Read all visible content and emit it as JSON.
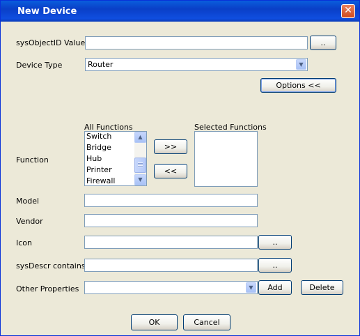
{
  "window": {
    "title": "New Device",
    "close_glyph": "✕"
  },
  "form": {
    "sysobjectid_label": "sysObjectID Value",
    "sysobjectid_value": "",
    "browse_label": "..",
    "device_type_label": "Device Type",
    "device_type_value": "Router",
    "options_label": "Options <<",
    "function_label": "Function",
    "all_functions_label": "All Functions",
    "all_functions": [
      "Switch",
      "Bridge",
      "Hub",
      "Printer",
      "Firewall"
    ],
    "selected_functions_label": "Selected Functions",
    "selected_functions": [],
    "add_function_label": ">>",
    "remove_function_label": "<<",
    "model_label": "Model",
    "model_value": "",
    "vendor_label": "Vendor",
    "vendor_value": "",
    "icon_label": "Icon",
    "icon_value": "",
    "icon_browse_label": "..",
    "sysdescr_label": "sysDescr contains",
    "sysdescr_value": "",
    "sysdescr_browse_label": "..",
    "other_props_label": "Other Properties",
    "other_props_value": "",
    "add_label": "Add",
    "delete_label": "Delete"
  },
  "footer": {
    "ok_label": "OK",
    "cancel_label": "Cancel"
  },
  "icons": {
    "dropdown": "chevron-down-icon",
    "scroll_up": "scroll-up-icon",
    "scroll_down": "scroll-down-icon",
    "close": "close-icon"
  }
}
